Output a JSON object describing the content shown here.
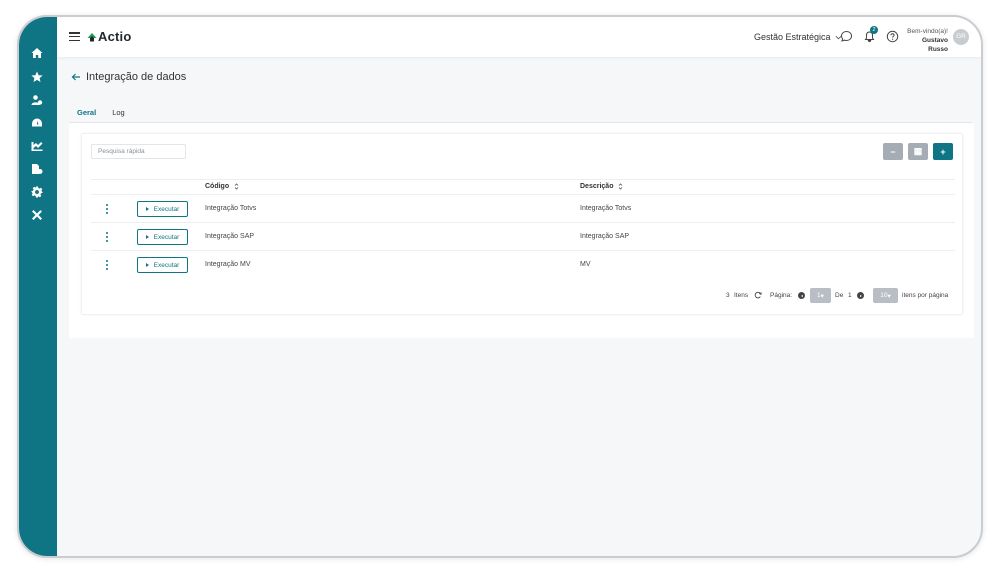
{
  "app": {
    "logo_text": "Actio"
  },
  "header": {
    "company": "Gestão Estratégica",
    "notification_count": "2",
    "welcome": "Bem-vindo(a)!",
    "user_name": "Gustavo Russo",
    "avatar_initials": "GR"
  },
  "sidebar": {
    "items": [
      {
        "icon": "home-icon"
      },
      {
        "icon": "star-icon"
      },
      {
        "icon": "users-icon"
      },
      {
        "icon": "dashboard-icon"
      },
      {
        "icon": "chart-icon"
      },
      {
        "icon": "documents-icon"
      },
      {
        "icon": "gear-icon"
      },
      {
        "icon": "tools-icon"
      }
    ]
  },
  "page": {
    "title": "Integração de dados"
  },
  "tabs": [
    {
      "label": "Geral",
      "active": true
    },
    {
      "label": "Log",
      "active": false
    }
  ],
  "search": {
    "placeholder": "Pesquisa rápida"
  },
  "toolbar": {
    "collapse_label": "−",
    "grid_label": "▦",
    "add_label": "+"
  },
  "table": {
    "columns": [
      "Código",
      "Descrição"
    ],
    "action_label": "Executar",
    "rows": [
      {
        "codigo": "Integração Totvs",
        "descricao": "Integração Totvs"
      },
      {
        "codigo": "Integração SAP",
        "descricao": "Integração SAP"
      },
      {
        "codigo": "Integração MV",
        "descricao": "MV"
      }
    ]
  },
  "pagination": {
    "total": "3",
    "items_label": "Itens",
    "page_label": "Página:",
    "current_page": "1",
    "of_label": "De",
    "total_pages": "1",
    "page_size": "10",
    "per_page_label": "itens por página"
  },
  "colors": {
    "accent": "#0f7585",
    "gray_button": "#a6acb3"
  }
}
